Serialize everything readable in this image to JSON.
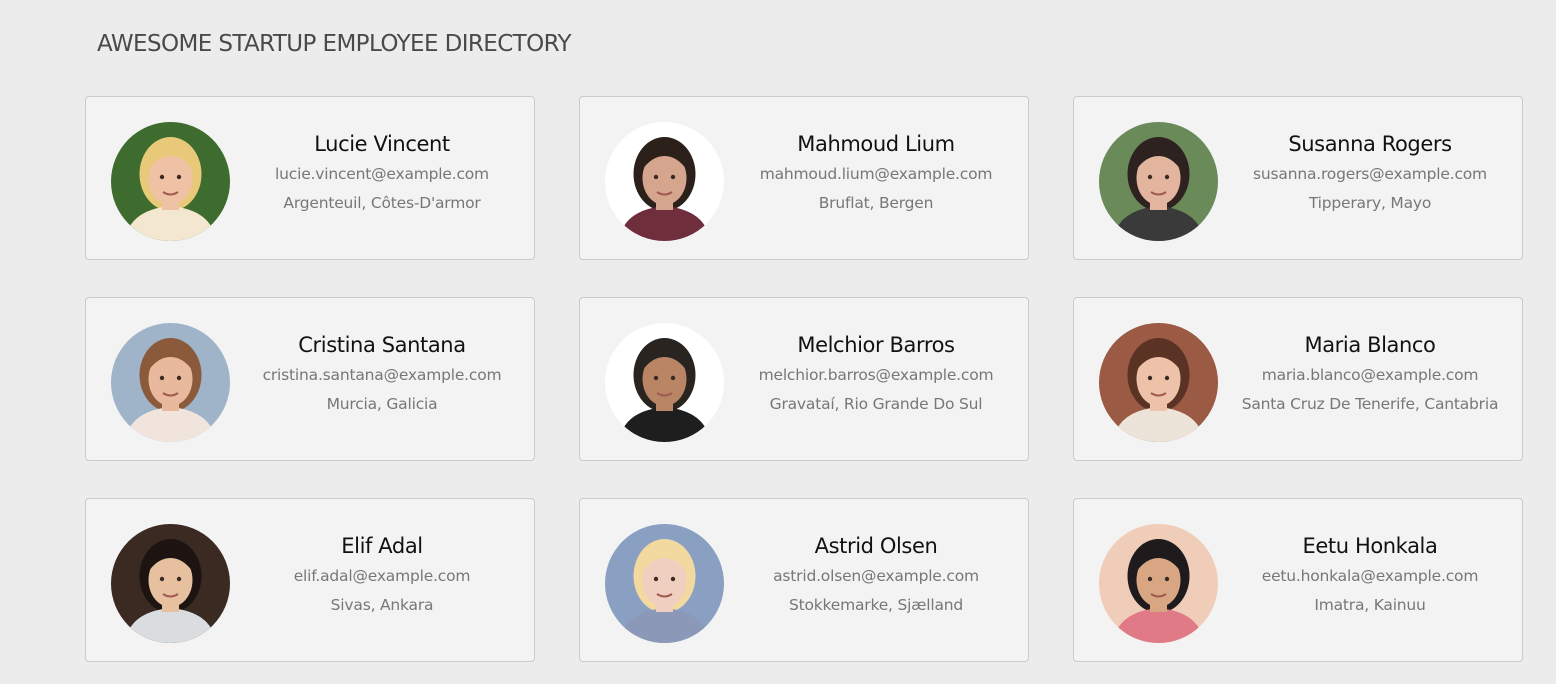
{
  "page": {
    "title": "AWESOME STARTUP EMPLOYEE DIRECTORY"
  },
  "employees": [
    {
      "name": "Lucie Vincent",
      "email": "lucie.vincent@example.com",
      "location": "Argenteuil, Côtes-D'armor",
      "avatar": {
        "bg": "#3e6b2e",
        "skin": "#f0c2a5",
        "hair": "#e8c97a",
        "shirt": "#f3e7cf"
      }
    },
    {
      "name": "Mahmoud Lium",
      "email": "mahmoud.lium@example.com",
      "location": "Bruflat, Bergen",
      "avatar": {
        "bg": "#ffffff",
        "skin": "#d6a58d",
        "hair": "#2b201a",
        "shirt": "#6e2e3c"
      }
    },
    {
      "name": "Susanna Rogers",
      "email": "susanna.rogers@example.com",
      "location": "Tipperary, Mayo",
      "avatar": {
        "bg": "#6a8a5a",
        "skin": "#e3b49e",
        "hair": "#2e2220",
        "shirt": "#3a3a3a"
      }
    },
    {
      "name": "Cristina Santana",
      "email": "cristina.santana@example.com",
      "location": "Murcia, Galicia",
      "avatar": {
        "bg": "#9fb4c9",
        "skin": "#e9b99e",
        "hair": "#8a5a3a",
        "shirt": "#f1e4dc"
      }
    },
    {
      "name": "Melchior Barros",
      "email": "melchior.barros@example.com",
      "location": "Gravataí, Rio Grande Do Sul",
      "avatar": {
        "bg": "#ffffff",
        "skin": "#b98565",
        "hair": "#2a2420",
        "shirt": "#1e1e1e"
      }
    },
    {
      "name": "Maria Blanco",
      "email": "maria.blanco@example.com",
      "location": "Santa Cruz De Tenerife, Cantabria",
      "avatar": {
        "bg": "#9b5a44",
        "skin": "#eec2a8",
        "hair": "#5a3324",
        "shirt": "#ece4d8"
      }
    },
    {
      "name": "Elif Adal",
      "email": "elif.adal@example.com",
      "location": "Sivas, Ankara",
      "avatar": {
        "bg": "#3a2a22",
        "skin": "#e7c0a0",
        "hair": "#1d1412",
        "shirt": "#d9dde0"
      }
    },
    {
      "name": "Astrid Olsen",
      "email": "astrid.olsen@example.com",
      "location": "Stokkemarke, Sjælland",
      "avatar": {
        "bg": "#8aa0c2",
        "skin": "#f1cfc0",
        "hair": "#f1d9a0",
        "shirt": "#8c98b8"
      }
    },
    {
      "name": "Eetu Honkala",
      "email": "eetu.honkala@example.com",
      "location": "Imatra, Kainuu",
      "avatar": {
        "bg": "#f0cdb8",
        "skin": "#d9a684",
        "hair": "#1f1a1c",
        "shirt": "#e07a86"
      }
    }
  ]
}
